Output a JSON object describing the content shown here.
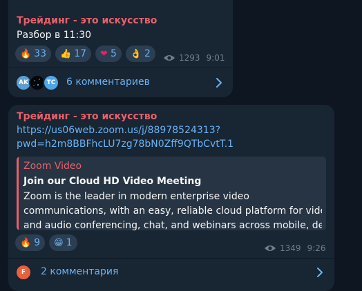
{
  "messages": [
    {
      "sender": "Трейдинг - это искусство",
      "text": "Разбор в 11:30",
      "reactions": [
        {
          "emoji": "🔥",
          "count": "33"
        },
        {
          "emoji": "👍",
          "count": "17"
        },
        {
          "emoji": "❤",
          "count": "5"
        },
        {
          "emoji": "👌",
          "count": "2"
        }
      ],
      "views": "1293",
      "time": "9:01",
      "commenters": [
        "AK",
        "",
        "TC"
      ],
      "comments_label": "6 комментариев"
    },
    {
      "sender": "Трейдинг - это искусство",
      "link_line1": "https://us06web.zoom.us/j/88978524313?",
      "link_line2": "pwd=h2m8BBFhcLU7zg78bN0Zff9QTbCvtT.1",
      "preview": {
        "site": "Zoom Video",
        "title": "Join our Cloud HD Video Meeting",
        "desc_line1": "Zoom is the leader in modern enterprise video",
        "desc_line2": "communications, with an easy, reliable cloud platform for video",
        "desc_line3": "and audio conferencing, chat, and webinars across mobile, de..."
      },
      "reactions": [
        {
          "emoji": "🔥",
          "count": "9"
        },
        {
          "emoji": "😁",
          "count": "1"
        }
      ],
      "views": "1349",
      "time": "9:26",
      "commenters": [
        "F"
      ],
      "comments_label": "2 комментария"
    }
  ],
  "colors": {
    "background": "#0e1621",
    "bubble": "#182533",
    "sender": "#e8616a",
    "link": "#6ab3f3",
    "meta": "#6d7f8f"
  }
}
